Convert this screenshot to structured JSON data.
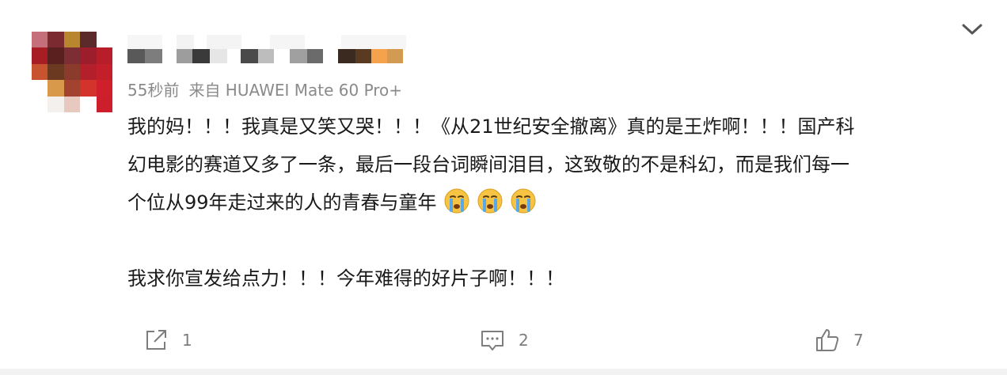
{
  "post": {
    "meta": {
      "time": "55秒前",
      "source": "来自 HUAWEI Mate 60 Pro+"
    },
    "content": {
      "lines": [
        "我的妈！！！我真是又笑又哭！！！《从21世纪安全撤离》真的是王炸啊！！！国产科",
        "幻电影的赛道又多了一条，最后一段台词瞬间泪目，这致敬的不是科幻，而是我们每一",
        "个位从99年走过来的人的青春与童年"
      ],
      "second_paragraph": "我求你宣发给点力！！！今年难得的好片子啊！！！",
      "emojis": [
        "crying-face-icon",
        "crying-face-icon",
        "crying-face-icon"
      ]
    },
    "actions": {
      "share_count": "1",
      "comment_count": "2",
      "like_count": "7"
    },
    "icons": {
      "more": "chevron-down-icon",
      "share": "share-icon",
      "comment": "comment-icon",
      "like": "thumbs-up-icon"
    },
    "colors": {
      "meta_text": "#8a8a8a",
      "content_text": "#1a1a1a",
      "action_text": "#7d7d7d",
      "emoji_yellow": "#f6c343",
      "emoji_tear": "#5aa9e6"
    }
  }
}
